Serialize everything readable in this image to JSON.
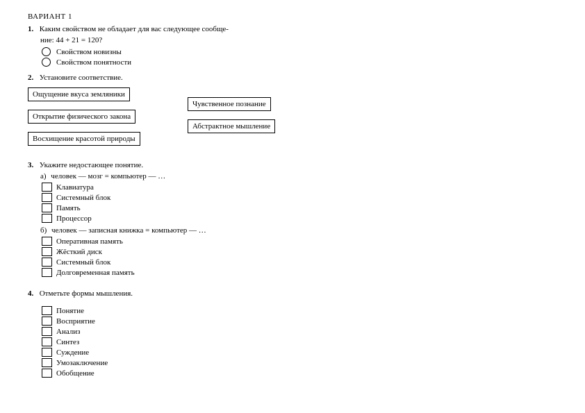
{
  "variant_title": "ВАРИАНТ 1",
  "q1": {
    "num": "1.",
    "text_line1": "Каким свойством не обладает для вас следующее сообще-",
    "text_line2": "ние: 44 + 21 = 120?",
    "options": [
      "Свойством новизны",
      "Свойством понятности"
    ]
  },
  "q2": {
    "num": "2.",
    "text": "Установите соответствие.",
    "left_items": [
      "Ощущение вкуса земляники",
      "Открытие физического закона",
      "Восхищение красотой природы"
    ],
    "right_items": [
      "Чувственное познание",
      "Абстрактное мышление"
    ]
  },
  "q3": {
    "num": "3.",
    "text": "Укажите недостающее понятие.",
    "sub_a_label": "а)",
    "sub_a_text": "человек — мозг = компьютер — …",
    "sub_a_options": [
      "Клавиатура",
      "Системный блок",
      "Память",
      "Процессор"
    ],
    "sub_b_label": "б)",
    "sub_b_text": "человек — записная книжка = компьютер — …",
    "sub_b_options": [
      "Оперативная память",
      "Жёсткий диск",
      "Системный блок",
      "Долговременная память"
    ]
  },
  "q4": {
    "num": "4.",
    "text": "Отметьте формы мышления.",
    "options": [
      "Понятие",
      "Восприятие",
      "Анализ",
      "Синтез",
      "Суждение",
      "Умозаключение",
      "Обобщение"
    ]
  }
}
